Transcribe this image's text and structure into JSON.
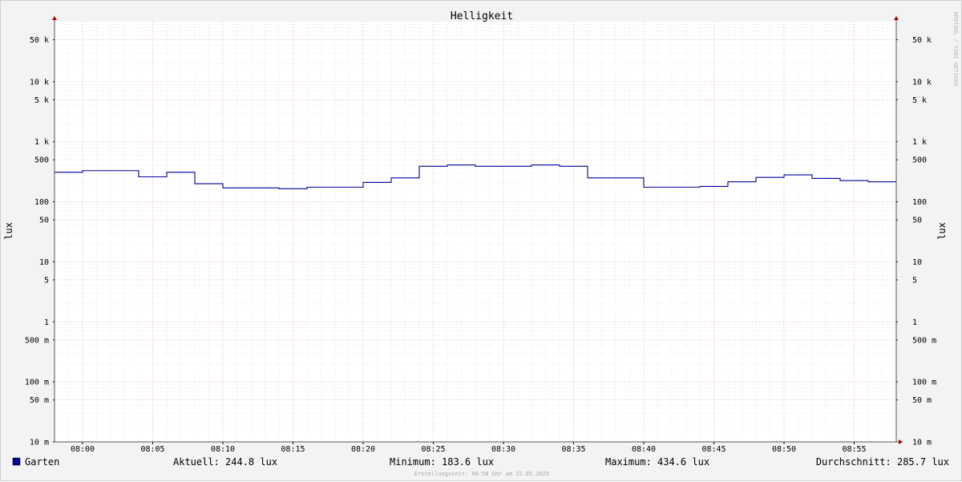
{
  "chart_data": {
    "type": "line",
    "title": "Helligkeit",
    "ylabel_left": "lux",
    "ylabel_right": "lux",
    "yscale": "log",
    "ylim": [
      0.01,
      100000
    ],
    "y_ticks": [
      {
        "value": 50000,
        "label": "50 k"
      },
      {
        "value": 10000,
        "label": "10 k"
      },
      {
        "value": 5000,
        "label": "5 k"
      },
      {
        "value": 1000,
        "label": "1 k"
      },
      {
        "value": 500,
        "label": "500"
      },
      {
        "value": 100,
        "label": "100"
      },
      {
        "value": 50,
        "label": "50"
      },
      {
        "value": 10,
        "label": "10"
      },
      {
        "value": 5,
        "label": "5"
      },
      {
        "value": 1,
        "label": "1"
      },
      {
        "value": 0.5,
        "label": "500 m"
      },
      {
        "value": 0.1,
        "label": "100 m"
      },
      {
        "value": 0.05,
        "label": "50 m"
      },
      {
        "value": 0.01,
        "label": "10 m"
      }
    ],
    "x_start": "07:58",
    "x_end": "08:58",
    "x_ticks": [
      "08:00",
      "08:05",
      "08:10",
      "08:15",
      "08:20",
      "08:25",
      "08:30",
      "08:35",
      "08:40",
      "08:45",
      "08:50",
      "08:55"
    ],
    "grid": true,
    "series": [
      {
        "name": "Garten",
        "color": "#000099",
        "step": true,
        "points": [
          {
            "x": "07:58",
            "y": 310
          },
          {
            "x": "08:00",
            "y": 330
          },
          {
            "x": "08:04",
            "y": 260
          },
          {
            "x": "08:06",
            "y": 310
          },
          {
            "x": "08:08",
            "y": 200
          },
          {
            "x": "08:10",
            "y": 170
          },
          {
            "x": "08:14",
            "y": 165
          },
          {
            "x": "08:16",
            "y": 175
          },
          {
            "x": "08:20",
            "y": 210
          },
          {
            "x": "08:22",
            "y": 250
          },
          {
            "x": "08:24",
            "y": 390
          },
          {
            "x": "08:26",
            "y": 410
          },
          {
            "x": "08:28",
            "y": 390
          },
          {
            "x": "08:32",
            "y": 410
          },
          {
            "x": "08:34",
            "y": 390
          },
          {
            "x": "08:36",
            "y": 250
          },
          {
            "x": "08:40",
            "y": 175
          },
          {
            "x": "08:44",
            "y": 180
          },
          {
            "x": "08:46",
            "y": 215
          },
          {
            "x": "08:48",
            "y": 255
          },
          {
            "x": "08:50",
            "y": 280
          },
          {
            "x": "08:52",
            "y": 245
          },
          {
            "x": "08:54",
            "y": 225
          },
          {
            "x": "08:56",
            "y": 215
          },
          {
            "x": "08:58",
            "y": 215
          }
        ]
      }
    ]
  },
  "legend": {
    "series_name": "Garten",
    "series_color": "#000099",
    "current": "Aktuell: 244.8 lux",
    "minimum": "Minimum: 183.6 lux",
    "maximum": "Maximum: 434.6 lux",
    "average": "Durchschnitt: 285.7 lux"
  },
  "footer": "Erstellungszeit: 08:58 Uhr am 22.05.2025",
  "watermark": "RRDTOOL / TOBI OETIKER"
}
